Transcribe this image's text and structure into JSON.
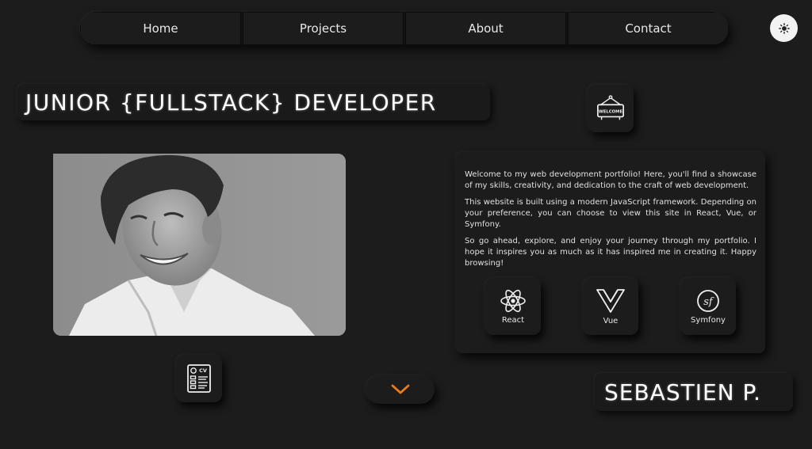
{
  "nav": {
    "items": [
      {
        "label": "Home"
      },
      {
        "label": "Projects"
      },
      {
        "label": "About"
      },
      {
        "label": "Contact"
      }
    ]
  },
  "theme_toggle": {
    "icon": "sun-icon"
  },
  "hero": {
    "title": "JUNIOR {FULLSTACK} DEVELOPER",
    "name": "SEBASTIEN P.",
    "welcome_sign_text": "WELCOME",
    "cv_icon_text": "CV"
  },
  "intro": {
    "paragraphs": [
      "Welcome to my web development portfolio! Here, you'll find a showcase of my skills, creativity, and dedication to the craft of web development.",
      "This website is built using a modern JavaScript framework. Depending on your preference, you can choose to view this site in React, Vue, or Symfony.",
      "So go ahead, explore, and enjoy your journey through my portfolio. I hope it inspires you as much as it has inspired me in creating it. Happy browsing!"
    ],
    "frameworks": [
      {
        "label": "React",
        "icon": "react-icon"
      },
      {
        "label": "Vue",
        "icon": "vue-icon"
      },
      {
        "label": "Symfony",
        "icon": "symfony-icon"
      }
    ]
  },
  "colors": {
    "background": "#1c1c1c",
    "text": "#e6e6e6",
    "accent": "#f07a1a",
    "toggle_bg": "#f2f2f2"
  }
}
